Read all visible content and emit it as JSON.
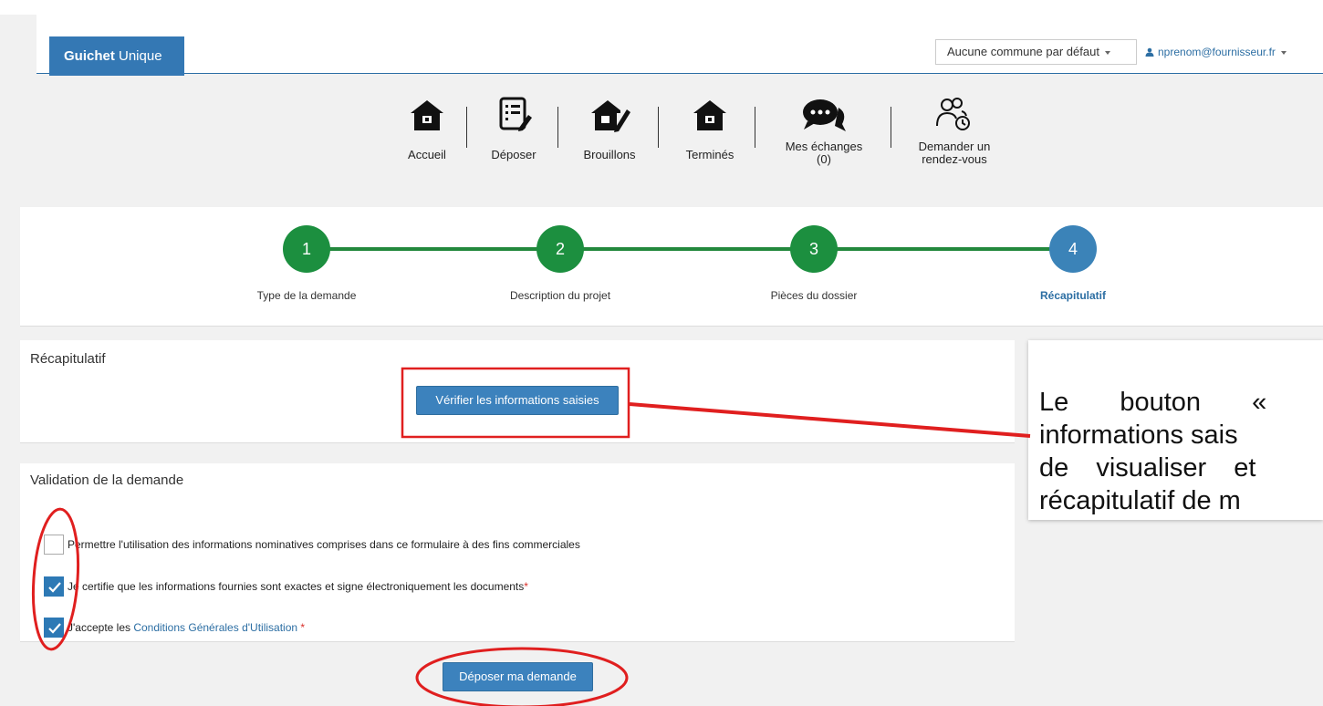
{
  "navbar": {
    "brand_bold": "Guichet",
    "brand_rest": " Unique",
    "commune_select": "Aucune commune par défaut",
    "user_email": "nprenom@fournisseur.fr"
  },
  "toolbar": {
    "items": [
      {
        "label": "Accueil",
        "icon": "home-icon"
      },
      {
        "label": "Déposer",
        "icon": "edit-document-icon"
      },
      {
        "label": "Brouillons",
        "icon": "home-edit-icon"
      },
      {
        "label": "Terminés",
        "icon": "home-icon"
      },
      {
        "label": "Mes échanges",
        "sublabel": "(0)",
        "icon": "chat-icon"
      },
      {
        "label": "Demander un",
        "sublabel": "rendez-vous",
        "icon": "users-clock-icon"
      }
    ]
  },
  "stepper": {
    "steps": [
      {
        "number": "1",
        "label": "Type de la demande",
        "state": "done"
      },
      {
        "number": "2",
        "label": "Description du projet",
        "state": "done"
      },
      {
        "number": "3",
        "label": "Pièces du dossier",
        "state": "done"
      },
      {
        "number": "4",
        "label": "Récapitulatif",
        "state": "active"
      }
    ],
    "colors": {
      "done": "#1c8f3f",
      "active": "#3b83b8"
    }
  },
  "recap": {
    "title": "Récapitulatif",
    "verify_button": "Vérifier les informations saisies"
  },
  "validation": {
    "title": "Validation de la demande",
    "checks": [
      {
        "text": "Permettre l'utilisation des informations nominatives comprises dans ce formulaire à des fins commerciales",
        "checked": false
      },
      {
        "text": "Je certifie que les informations fournies sont exactes et signe électroniquement les documents",
        "required": "*",
        "checked": true
      },
      {
        "text_before": "J'accepte les ",
        "link": "Conditions Générales d'Utilisation",
        "required": " *",
        "checked": true
      }
    ]
  },
  "submit_button": "Déposer ma demande",
  "callout": {
    "lines": [
      "Le bouton «",
      "informations sais",
      "de visualiser et",
      "récapitulatif de m"
    ]
  },
  "accent_colors": {
    "brand": "#3478b4",
    "annotation": "#e01f1f"
  }
}
